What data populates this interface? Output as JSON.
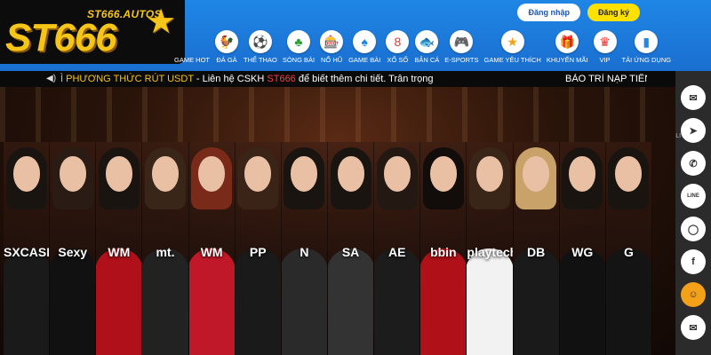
{
  "brand": {
    "logo_main": "ST666",
    "logo_url": "ST666.AUTOS"
  },
  "auth": {
    "login_label": "Đăng nhập",
    "register_label": "Đăng ký"
  },
  "nav": [
    {
      "label": "GAME HOT",
      "icon": "flame-icon",
      "glyph": "🔥",
      "color": "#ff6a00"
    },
    {
      "label": "ĐÁ GÀ",
      "icon": "rooster-icon",
      "glyph": "🐓",
      "color": "#e53935"
    },
    {
      "label": "THỂ THAO",
      "icon": "soccer-ball-icon",
      "glyph": "⚽",
      "color": "#1e88e5"
    },
    {
      "label": "SÒNG BÀI",
      "icon": "casino-chip-icon",
      "glyph": "♣",
      "color": "#2e9e3a"
    },
    {
      "label": "NỔ HŨ",
      "icon": "slot-machine-icon",
      "glyph": "🎰",
      "color": "#ff8f00"
    },
    {
      "label": "GAME BÀI",
      "icon": "playing-cards-icon",
      "glyph": "♠",
      "color": "#1e88e5"
    },
    {
      "label": "XỔ SỐ",
      "icon": "lottery-ball-icon",
      "glyph": "8",
      "color": "#e53935"
    },
    {
      "label": "BẮN CÁ",
      "icon": "fish-icon",
      "glyph": "🐟",
      "color": "#00acc1"
    },
    {
      "label": "E-SPORTS",
      "icon": "gamepad-icon",
      "glyph": "🎮",
      "color": "#5c6bc0"
    },
    {
      "label": "GAME YÊU THÍCH",
      "icon": "star-icon",
      "glyph": "★",
      "color": "#f4a11a"
    },
    {
      "label": "KHUYẾN MÃI",
      "icon": "gift-icon",
      "glyph": "🎁",
      "color": "#e53935"
    },
    {
      "label": "VIP",
      "icon": "crown-icon",
      "glyph": "♛",
      "color": "#e53935"
    },
    {
      "label": "TẢI ỨNG DỤNG",
      "icon": "phone-download-icon",
      "glyph": "▮",
      "color": "#1e88e5"
    }
  ],
  "ticker": {
    "prefix": "Ì PHƯƠNG THỨC RÚT USDT",
    "middle": " - Liên hệ CSKH ",
    "brand": "ST666",
    "suffix": " để biết thêm chi tiết. Trân trọng",
    "maintenance": "BẢO TRÌ NẠP TIỀN"
  },
  "dealers": [
    {
      "brand": "SXCASINO",
      "hair": "#1a1410",
      "dress": "#1a1a1a"
    },
    {
      "brand": "Sexy",
      "hair": "#2a1c14",
      "dress": "#111"
    },
    {
      "brand": "WM",
      "hair": "#1a1410",
      "dress": "#b0101a"
    },
    {
      "brand": "mt.",
      "hair": "#3a2618",
      "dress": "#222"
    },
    {
      "brand": "WM",
      "hair": "#7a2a18",
      "dress": "#c01828"
    },
    {
      "brand": "PP",
      "hair": "#3a2418",
      "dress": "#1a1a1a"
    },
    {
      "brand": "N",
      "hair": "#1a1410",
      "dress": "#2a2a2a"
    },
    {
      "brand": "SA",
      "hair": "#1a1410",
      "dress": "#333"
    },
    {
      "brand": "AE",
      "hair": "#231812",
      "dress": "#1c1c1c"
    },
    {
      "brand": "bbin",
      "hair": "#120c0a",
      "dress": "#b01018"
    },
    {
      "brand": "playtech",
      "hair": "#3a2618",
      "dress": "#f2f2f2"
    },
    {
      "brand": "DB",
      "hair": "#c9a26a",
      "dress": "#1a1a1a"
    },
    {
      "brand": "WG",
      "hair": "#1a1410",
      "dress": "#111"
    },
    {
      "brand": "G",
      "hair": "#1a1410",
      "dress": "#141414"
    }
  ],
  "side": {
    "label": "LIVECHAT",
    "buttons": [
      {
        "name": "livechat-button",
        "icon": "chat-icon",
        "glyph": "✉"
      },
      {
        "name": "telegram-button",
        "icon": "telegram-icon",
        "glyph": "➤"
      },
      {
        "name": "whatsapp-button",
        "icon": "whatsapp-icon",
        "glyph": "✆"
      },
      {
        "name": "line-button",
        "icon": "line-icon",
        "glyph": "LINE"
      },
      {
        "name": "signal-button",
        "icon": "signal-icon",
        "glyph": "◯"
      },
      {
        "name": "facebook-button",
        "icon": "facebook-icon",
        "glyph": "f"
      },
      {
        "name": "support-avatar-button",
        "icon": "support-agent-icon",
        "glyph": "☺"
      },
      {
        "name": "email-button",
        "icon": "mail-icon",
        "glyph": "✉"
      }
    ]
  }
}
